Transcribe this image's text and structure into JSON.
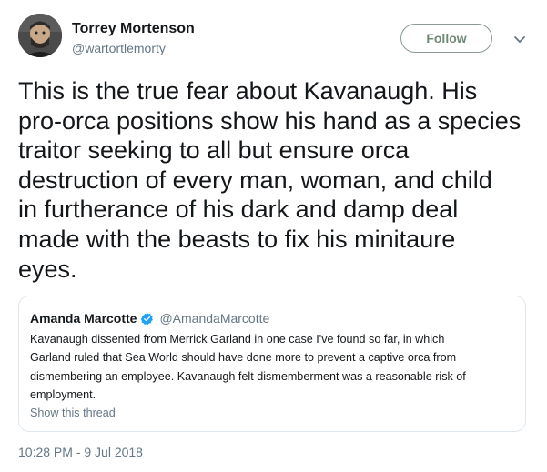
{
  "author": {
    "display_name": "Torrey Mortenson",
    "screen_name": "@wartortlemorty"
  },
  "follow_label": "Follow",
  "tweet": {
    "lines": [
      "This is the true fear about Kavanaugh. His",
      "pro-orca positions show his hand as a species",
      "traitor seeking to all but ensure orca",
      "destruction of every man, woman, and child",
      "in furtherance of his dark and damp deal",
      "made with the beasts to fix his minitaure",
      "eyes."
    ]
  },
  "quote": {
    "display_name": "Amanda Marcotte",
    "screen_name": "@AmandaMarcotte",
    "lines": [
      "Kavanaugh dissented from Merrick Garland in one case I've found so far, in which",
      "Garland ruled that Sea World should have done more to prevent a captive orca from",
      "dismembering an employee. Kavanaugh felt dismemberment was a reasonable risk of",
      "employment."
    ],
    "show_thread_label": "Show this thread"
  },
  "timestamp": "10:28 PM - 9 Jul 2018",
  "icons": {
    "avatar": "profile-photo",
    "caret": "chevron-down-icon",
    "verified": "verified-badge-icon"
  },
  "colors": {
    "text": "#14171a",
    "secondary": "#657786",
    "verified": "#1da1f2",
    "follow": "#6f8a74"
  }
}
